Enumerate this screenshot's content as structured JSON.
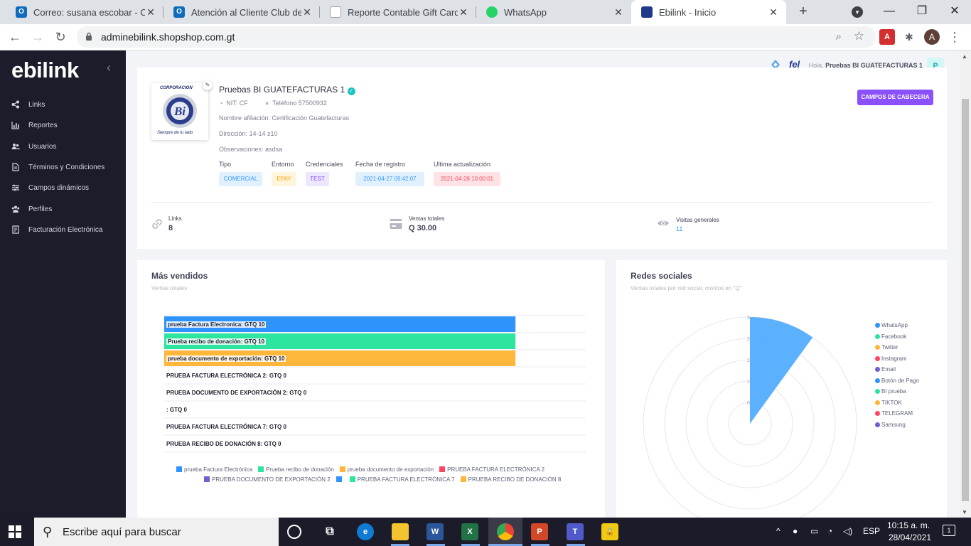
{
  "browser": {
    "tabs": [
      {
        "title": "Correo: susana escobar - Out",
        "icon": "outlook-icon"
      },
      {
        "title": "Atención al Cliente Club de C",
        "icon": "outlook-icon"
      },
      {
        "title": "Reporte Contable Gift Cards -",
        "icon": "doc-icon"
      },
      {
        "title": "WhatsApp",
        "icon": "whatsapp-icon"
      },
      {
        "title": "Ebilink - Inicio",
        "icon": "ebilink-icon"
      }
    ],
    "url": "adminebilink.shopshop.com.gt",
    "profile_initial": "A",
    "pdf_ext": "A"
  },
  "sidebar": {
    "logo": "ebilink",
    "items": [
      {
        "label": "Links",
        "icon": "share-icon"
      },
      {
        "label": "Reportes",
        "icon": "bar-chart-icon"
      },
      {
        "label": "Usuarios",
        "icon": "users-icon"
      },
      {
        "label": "Términos y Condiciones",
        "icon": "document-icon"
      },
      {
        "label": "Campos dinámicos",
        "icon": "sliders-icon"
      },
      {
        "label": "Perfiles",
        "icon": "profiles-icon"
      },
      {
        "label": "Facturación Electrónica",
        "icon": "invoice-icon"
      }
    ]
  },
  "header": {
    "fel_logo": "fel",
    "hello_prefix": "Hola,",
    "hello_name": "Pruebas BI GUATEFACTURAS 1",
    "avatar": "P"
  },
  "company": {
    "logo_top": "CORPORACION",
    "logo_mark": "Bi",
    "logo_bottom": "Siempre de tu lado",
    "name": "Pruebas BI GUATEFACTURAS 1",
    "nit": "NIT: CF",
    "telefono": "Teléfono 57500932",
    "afiliacion": "Nombre afiliación: Certificación Guatefacturas",
    "direccion": "Dirección: 14-14 z10",
    "observaciones": "Observaciones: asdsa",
    "headers": {
      "tipo": "Tipo",
      "entorno": "Entorno",
      "credenciales": "Credenciales",
      "fecha": "Fecha de registro",
      "ultima": "Ultima actualización"
    },
    "values": {
      "tipo": "COMERCIAL",
      "entorno": "EPAY",
      "credenciales": "TEST",
      "fecha": "2021-04-27 09:42:07",
      "ultima": "2021-04-28 10:00:01"
    },
    "button": "CAMPOS DE CABECERA"
  },
  "stats": {
    "links_label": "Links",
    "links_value": "8",
    "ventas_label": "Ventas totales",
    "ventas_value": "Q 30.00",
    "visitas_label": "Visitas generales",
    "visitas_value": "11"
  },
  "sales": {
    "title": "Más vendidos",
    "subtitle": "Ventas totales"
  },
  "social": {
    "title": "Redes sociales",
    "subtitle": "Ventas totales por red social, montos en \"Q\""
  },
  "chart_data": [
    {
      "type": "bar",
      "orientation": "horizontal",
      "categories": [
        "prueba Factura Electronica",
        "Prueba recibo de donación",
        "prueba documento de exportación",
        "PRUEBA FACTURA ELECTRÓNICA 2",
        "PRUEBA DOCUMENTO DE EXPORTACIÓN 2",
        "",
        "PRUEBA FACTURA ELECTRÓNICA 7",
        "PRUEBA RECIBO DE DONACIÓN 8"
      ],
      "labels": [
        "prueba Factura Electronica: GTQ 10",
        "Prueba recibo de donación: GTQ 10",
        "prueba documento de exportación: GTQ 10",
        "PRUEBA FACTURA ELECTRÓNICA 2: GTQ 0",
        "PRUEBA DOCUMENTO DE EXPORTACIÓN 2: GTQ 0",
        ": GTQ 0",
        "PRUEBA FACTURA ELECTRÓNICA 7: GTQ 0",
        "PRUEBA RECIBO DE DONACIÓN 8: GTQ 0"
      ],
      "values": [
        10,
        10,
        10,
        0,
        0,
        0,
        0,
        0
      ],
      "colors": [
        "#2e93fa",
        "#2ee5a0",
        "#feb63b",
        "#ff4560",
        "#775dd0",
        "#2e93fa",
        "#2ee5a0",
        "#feb63b"
      ],
      "legend": [
        "prueba Factura Electrónica",
        "Prueba recibo de donación",
        "prueba documento de exportación",
        "PRUEBA FACTURA ELECTRÓNICA 2",
        "PRUEBA DOCUMENTO DE EXPORTACIÓN 2",
        "",
        "PRUEBA FACTURA ELECTRÓNICA 7",
        "PRUEBA RECIBO DE DONACIÓN 8"
      ],
      "xlim": [
        0,
        12
      ]
    },
    {
      "type": "polar-area",
      "categories": [
        "WhatsApp",
        "Facebook",
        "Twitter",
        "Instagram",
        "Email",
        "Botón de Pago",
        "BI prueba",
        "TIKTOK",
        "TELEGRAM",
        "Samsung"
      ],
      "values": [
        3,
        0,
        0,
        0,
        0,
        0,
        0,
        0,
        0,
        0
      ],
      "colors": [
        "#2e93fa",
        "#2ee5a0",
        "#feb63b",
        "#ff4560",
        "#775dd0",
        "#2e93fa",
        "#2ee5a0",
        "#feb63b",
        "#ff4560",
        "#775dd0"
      ],
      "radial_ticks": [
        "3",
        "2",
        "1",
        "1",
        "0"
      ],
      "legend_position": "right"
    }
  ],
  "taskbar": {
    "search_placeholder": "Escribe aquí para buscar",
    "lang": "ESP",
    "time": "10:15 a. m.",
    "date": "28/04/2021",
    "notifications": "1"
  }
}
